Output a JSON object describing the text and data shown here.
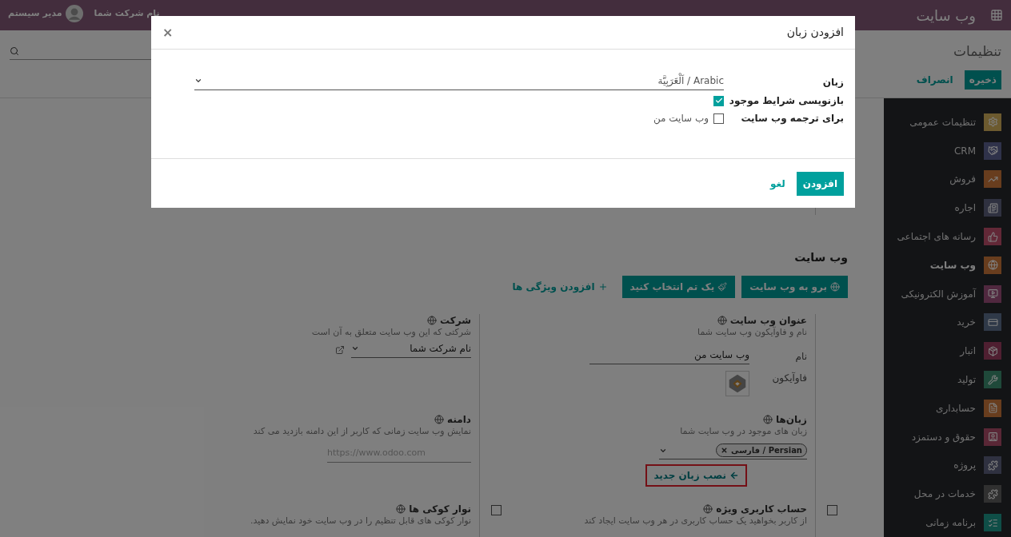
{
  "navbar": {
    "app_title": "وب سایت",
    "company": "نام شرکت شما",
    "user": "مدیر سیستم"
  },
  "control_panel": {
    "title": "تنظیمات",
    "save": "ذخیره",
    "discard": "انصراف"
  },
  "sidebar": {
    "items": [
      {
        "label": "تنظیمات عمومی",
        "selected": false
      },
      {
        "label": "CRM",
        "selected": false
      },
      {
        "label": "فروش",
        "selected": false
      },
      {
        "label": "اجاره",
        "selected": false
      },
      {
        "label": "رسانه های اجتماعی",
        "selected": false
      },
      {
        "label": "وب سایت",
        "selected": true
      },
      {
        "label": "آموزش الکترونیکی",
        "selected": false
      },
      {
        "label": "خرید",
        "selected": false
      },
      {
        "label": "انبار",
        "selected": false
      },
      {
        "label": "تولید",
        "selected": false
      },
      {
        "label": "حسابداری",
        "selected": false
      },
      {
        "label": "حقوق و دستمزد",
        "selected": false
      },
      {
        "label": "پروژه",
        "selected": false
      },
      {
        "label": "خدمات در محل",
        "selected": false
      },
      {
        "label": "برنامه زمانی",
        "selected": false
      }
    ]
  },
  "content": {
    "section_title": "وب سایت",
    "actions": [
      {
        "label": "برو به وب سایت",
        "kind": "primary"
      },
      {
        "label": "یک تم انتخاب کنید",
        "kind": "primary"
      },
      {
        "label": "افزودن ویژگی ها",
        "kind": "link"
      }
    ],
    "settings": [
      {
        "kind": "website_info",
        "title": "عنوان وب سایت",
        "description": "نام و فاوآیکون وب سایت شما",
        "name_label": "نام",
        "name_value": "وب سایت من",
        "favicon_label": "فاوآیکون"
      },
      {
        "kind": "select",
        "title": "شرکت",
        "description": "شرکتی که این وب سایت متعلق به آن است",
        "value": "نام شرکت شما"
      },
      {
        "kind": "tags",
        "title": "زبان‌ها",
        "description": "زبان های موجود در وب سایت شما",
        "tags": [
          "Persian / فارسی"
        ],
        "link": "نصب زبان جدید",
        "highlighted": true
      },
      {
        "kind": "input",
        "title": "دامنه",
        "description": "نمایش وب سایت زمانی که کاربر از این دامنه بازدید می کند",
        "placeholder": "https://www.odoo.com"
      },
      {
        "kind": "checkbox",
        "title": "حساب کاربری ویژه",
        "description": "از کاربر بخواهید یک حساب کاربری در هر وب سایت ایجاد کند",
        "checked": false
      },
      {
        "kind": "checkbox",
        "title": "نوار کوکی ها",
        "description": "نوار کوکی های قابل تنظیم را در وب سایت خود نمایش دهید.",
        "checked": false
      }
    ]
  },
  "modal": {
    "title": "افزودن زبان",
    "close": "×",
    "language_label": "زبان",
    "language_value": "Arabic / اَلْعَرَبِيَّة",
    "overwrite_label": "بازنویسی شرایط موجود",
    "overwrite_checked": true,
    "translate_label": "برای ترجمه وب سایت",
    "websites": [
      {
        "label": "وب سایت من",
        "checked": false
      }
    ],
    "primary_button": "افزودن",
    "cancel_button": "لغو"
  }
}
